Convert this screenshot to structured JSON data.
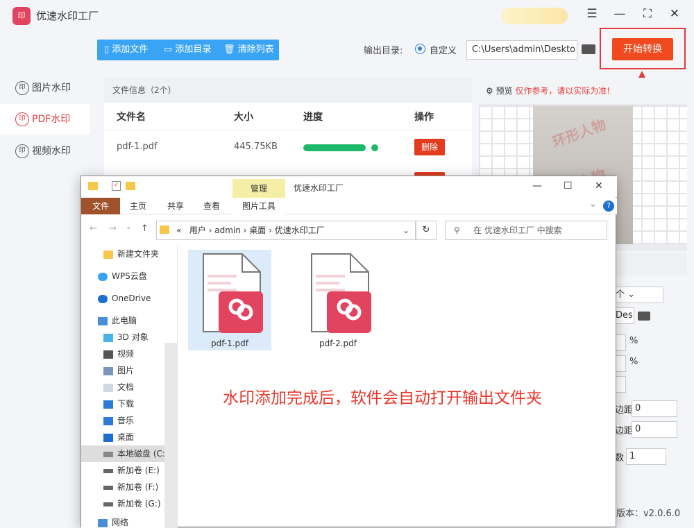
{
  "app": {
    "title": "优速水印工厂",
    "logo": "印",
    "window_controls": [
      "menu-icon",
      "minimize-icon",
      "maximize-icon",
      "close-icon"
    ]
  },
  "sidebar": {
    "items": [
      {
        "label": "图片水印",
        "icon": "印",
        "active": false
      },
      {
        "label": "PDF水印",
        "icon": "印",
        "active": true
      },
      {
        "label": "视频水印",
        "icon": "印",
        "active": false
      }
    ]
  },
  "toolbar": {
    "add_file": "添加文件",
    "add_dir": "添加目录",
    "clear": "清除列表"
  },
  "output": {
    "label": "输出目录:",
    "mode": "自定义",
    "path": "C:\\Users\\admin\\Deskto"
  },
  "start_label": "开始转换",
  "file_panel": {
    "info": "文件信息（2个）",
    "headers": [
      "文件名",
      "大小",
      "进度",
      "操作"
    ],
    "rows": [
      {
        "name": "pdf-1.pdf",
        "size": "445.75KB",
        "progress": 1.0,
        "action": "删除"
      }
    ]
  },
  "preview": {
    "label": "预览",
    "note": "仅作参考，请以实际为准!",
    "watermark": "环形人物"
  },
  "right_controls": {
    "count": "个",
    "path_fragment": "Des",
    "pct": "%",
    "margin_label": "边距",
    "margin_val": "0",
    "count_label": "数",
    "count_val": "1"
  },
  "version": "版本：v2.0.6.0",
  "explorer": {
    "manage": "管理",
    "title": "优速水印工厂",
    "tabs": {
      "file": "文件",
      "home": "主页",
      "share": "共享",
      "view": "查看",
      "pic_tools": "图片工具"
    },
    "breadcrumb": [
      "«",
      "用户",
      "admin",
      "桌面",
      "优速水印工厂"
    ],
    "search_placeholder": "在 优速水印工厂 中搜索",
    "nav": [
      "新建文件夹",
      "WPS云盘",
      "OneDrive",
      "此电脑",
      "3D 对象",
      "视频",
      "图片",
      "文档",
      "下载",
      "音乐",
      "桌面",
      "本地磁盘 (C:)",
      "新加卷 (E:)",
      "新加卷 (F:)",
      "新加卷 (G:)",
      "网络"
    ],
    "files": [
      "pdf-1.pdf",
      "pdf-2.pdf"
    ],
    "message": "水印添加完成后，软件会自动打开输出文件夹"
  },
  "colors": {
    "accent": "#e23b3b",
    "toolbar": "#3aa4f4",
    "start": "#f04a1e",
    "progress": "#1db86a"
  }
}
